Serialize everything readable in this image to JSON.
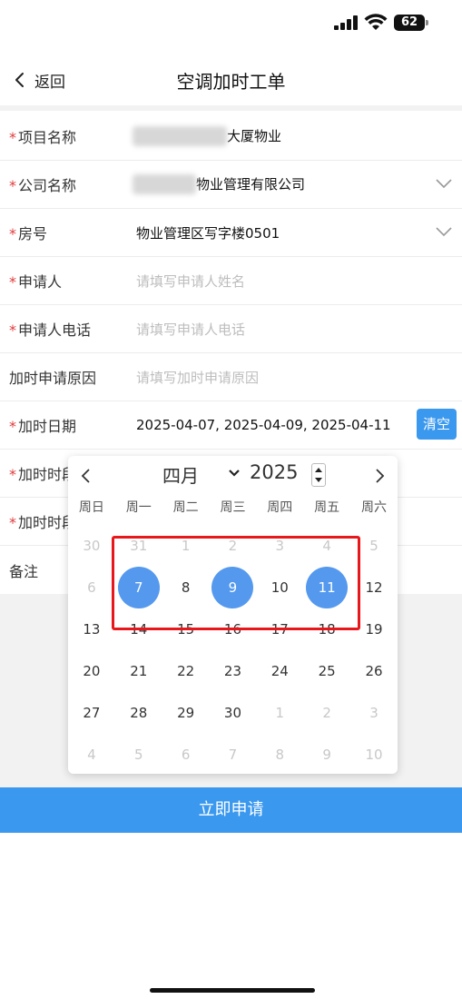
{
  "status_bar": {
    "battery": "62"
  },
  "nav": {
    "back_label": "返回",
    "title": "空调加时工单"
  },
  "form": {
    "project_name": {
      "label": "项目名称",
      "required": "*",
      "value_suffix": "大厦物业"
    },
    "company_name": {
      "label": "公司名称",
      "required": "*",
      "value_suffix": "物业管理有限公司"
    },
    "room_no": {
      "label": "房号",
      "required": "*",
      "value": "物业管理区写字楼0501"
    },
    "applicant": {
      "label": "申请人",
      "required": "*",
      "placeholder": "请填写申请人姓名"
    },
    "applicant_phone": {
      "label": "申请人电话",
      "required": "*",
      "placeholder": "请填写申请人电话"
    },
    "overtime_reason": {
      "label": "加时申请原因",
      "placeholder": "请填写加时申请原因"
    },
    "overtime_date": {
      "label": "加时日期",
      "required": "*",
      "value": "2025-04-07, 2025-04-09, 2025-04-11",
      "clear_label": "清空"
    },
    "overtime_start": {
      "label": "加时时段",
      "required": "*"
    },
    "overtime_end": {
      "label": "加时时段",
      "required": "*"
    },
    "remarks": {
      "label": "备注"
    }
  },
  "calendar": {
    "month": "四月",
    "year": "2025",
    "weekdays": [
      "周日",
      "周一",
      "周二",
      "周三",
      "周四",
      "周五",
      "周六"
    ],
    "weeks": [
      [
        {
          "d": "30",
          "o": true
        },
        {
          "d": "31",
          "o": true
        },
        {
          "d": "1",
          "o": true
        },
        {
          "d": "2",
          "o": true
        },
        {
          "d": "3",
          "o": true
        },
        {
          "d": "4",
          "o": true
        },
        {
          "d": "5",
          "o": true
        }
      ],
      [
        {
          "d": "6",
          "o": true
        },
        {
          "d": "7",
          "s": true
        },
        {
          "d": "8"
        },
        {
          "d": "9",
          "s": true
        },
        {
          "d": "10"
        },
        {
          "d": "11",
          "s": true
        },
        {
          "d": "12"
        }
      ],
      [
        {
          "d": "13"
        },
        {
          "d": "14"
        },
        {
          "d": "15"
        },
        {
          "d": "16"
        },
        {
          "d": "17"
        },
        {
          "d": "18"
        },
        {
          "d": "19"
        }
      ],
      [
        {
          "d": "20"
        },
        {
          "d": "21"
        },
        {
          "d": "22"
        },
        {
          "d": "23"
        },
        {
          "d": "24"
        },
        {
          "d": "25"
        },
        {
          "d": "26"
        }
      ],
      [
        {
          "d": "27"
        },
        {
          "d": "28"
        },
        {
          "d": "29"
        },
        {
          "d": "30"
        },
        {
          "d": "1",
          "o": true
        },
        {
          "d": "2",
          "o": true
        },
        {
          "d": "3",
          "o": true
        }
      ],
      [
        {
          "d": "4",
          "o": true
        },
        {
          "d": "5",
          "o": true
        },
        {
          "d": "6",
          "o": true
        },
        {
          "d": "7",
          "o": true
        },
        {
          "d": "8",
          "o": true
        },
        {
          "d": "9",
          "o": true
        },
        {
          "d": "10",
          "o": true
        }
      ]
    ]
  },
  "submit": {
    "label": "立即申请"
  },
  "colors": {
    "primary": "#3a98ee",
    "selected": "#5499ee",
    "required": "#e23b3b",
    "highlight": "#e8171b"
  }
}
